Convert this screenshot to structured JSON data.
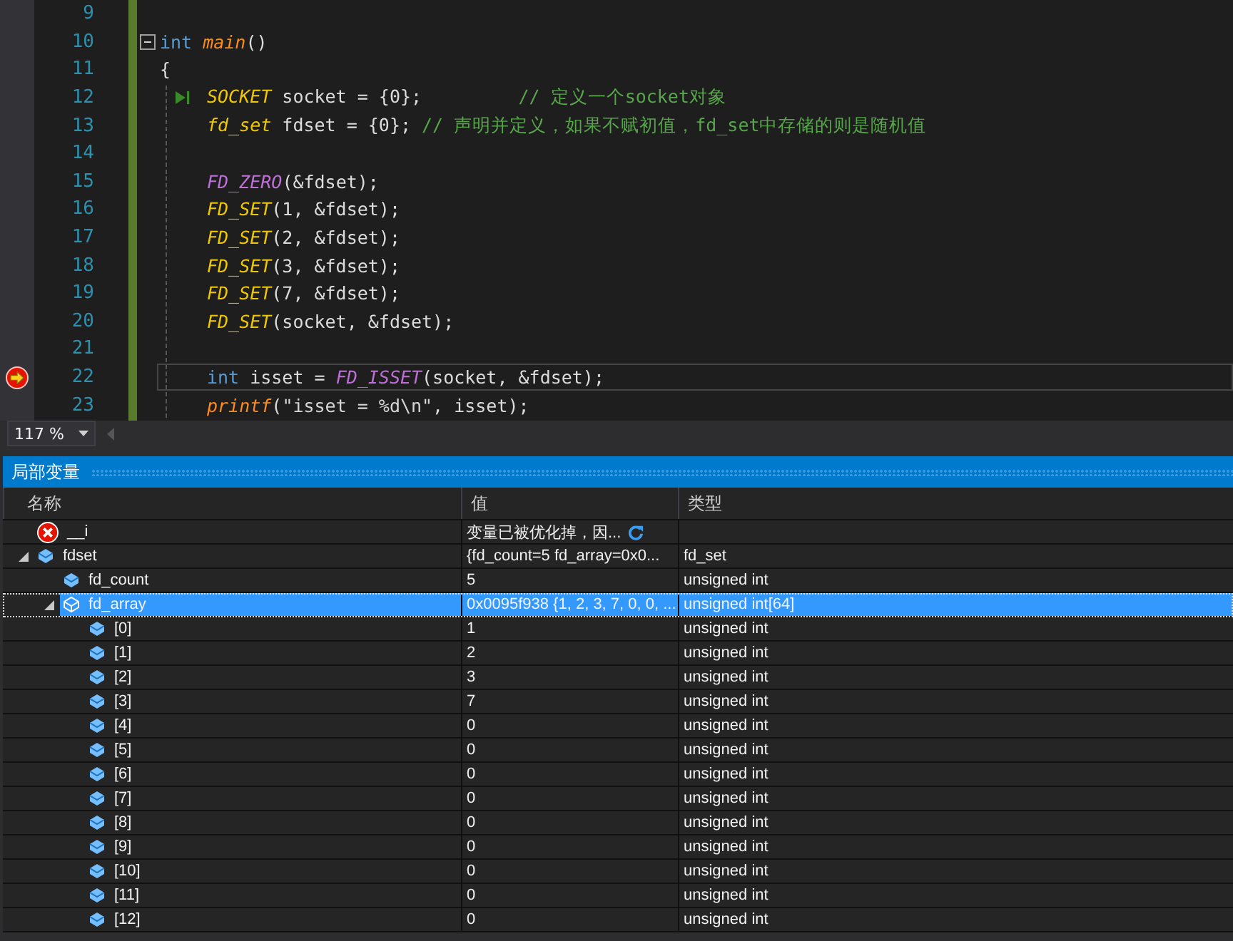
{
  "editor": {
    "lines": [
      {
        "number": "9"
      },
      {
        "number": "10",
        "collapsible": true,
        "tokens": [
          {
            "kind": "kw",
            "text": "int "
          },
          {
            "kind": "fn",
            "text": "main"
          },
          {
            "kind": "plain",
            "text": "()"
          }
        ]
      },
      {
        "number": "11",
        "tokens": [
          {
            "kind": "plain",
            "text": "{"
          }
        ],
        "children": [
          {
            "number": "12",
            "step_marker": true,
            "tokens": [
              {
                "kind": "type",
                "text": "SOCKET"
              },
              {
                "kind": "plain",
                "text": " socket = {0};         "
              },
              {
                "kind": "comment",
                "text": "// 定义一个socket对象"
              }
            ]
          },
          {
            "number": "13",
            "tokens": [
              {
                "kind": "type",
                "text": "fd_set"
              },
              {
                "kind": "plain",
                "text": " fdset = {0}; "
              },
              {
                "kind": "comment",
                "text": "// 声明并定义，如果不赋初值，fd_set中存储的则是随机值"
              }
            ]
          },
          {
            "number": "14"
          },
          {
            "number": "15",
            "tokens": [
              {
                "kind": "macro",
                "text": "FD_ZERO"
              },
              {
                "kind": "plain",
                "text": "(&fdset);"
              }
            ]
          },
          {
            "number": "16",
            "tokens": [
              {
                "kind": "type",
                "text": "FD_SET"
              },
              {
                "kind": "plain",
                "text": "(1, &fdset);"
              }
            ]
          },
          {
            "number": "17",
            "tokens": [
              {
                "kind": "type",
                "text": "FD_SET"
              },
              {
                "kind": "plain",
                "text": "(2, &fdset);"
              }
            ]
          },
          {
            "number": "18",
            "tokens": [
              {
                "kind": "type",
                "text": "FD_SET"
              },
              {
                "kind": "plain",
                "text": "(3, &fdset);"
              }
            ]
          },
          {
            "number": "19",
            "tokens": [
              {
                "kind": "type",
                "text": "FD_SET"
              },
              {
                "kind": "plain",
                "text": "(7, &fdset);"
              }
            ]
          },
          {
            "number": "20",
            "tokens": [
              {
                "kind": "type",
                "text": "FD_SET"
              },
              {
                "kind": "plain",
                "text": "(socket, &fdset);"
              }
            ]
          },
          {
            "number": "21"
          },
          {
            "number": "22",
            "current": true,
            "breakpoint": true,
            "tokens": [
              {
                "kind": "kw",
                "text": "int"
              },
              {
                "kind": "plain",
                "text": " isset = "
              },
              {
                "kind": "macro",
                "text": "FD_ISSET"
              },
              {
                "kind": "plain",
                "text": "(socket, &fdset);"
              }
            ]
          },
          {
            "number": "23",
            "tokens": [
              {
                "kind": "fn",
                "text": "printf"
              },
              {
                "kind": "plain",
                "text": "("
              },
              {
                "kind": "string",
                "text": "\"isset = %d\\n\""
              },
              {
                "kind": "plain",
                "text": ", isset);"
              }
            ]
          }
        ]
      }
    ]
  },
  "zoom": {
    "value": "117 %"
  },
  "locals": {
    "title": "局部变量",
    "columns": [
      "名称",
      "值",
      "类型"
    ],
    "rows": [
      {
        "kind": "error",
        "name": "__i",
        "value": "变量已被优化掉，因...",
        "refresh": true,
        "selected": false
      },
      {
        "kind": "variable",
        "name": "fdset",
        "value": "{fd_count=5 fd_array=0x0...",
        "type": "fd_set",
        "expanded": true,
        "selected": false,
        "children": [
          {
            "kind": "variable",
            "name": "fd_count",
            "value": "5",
            "type": "unsigned int",
            "selected": false
          },
          {
            "kind": "variable",
            "name": "fd_array",
            "value": "0x0095f938 {1, 2, 3, 7, 0, 0, ...",
            "type": "unsigned int[64]",
            "expanded": true,
            "selected": true,
            "children": [
              {
                "kind": "variable",
                "name": "[0]",
                "value": "1",
                "type": "unsigned int",
                "selected": false
              },
              {
                "kind": "variable",
                "name": "[1]",
                "value": "2",
                "type": "unsigned int",
                "selected": false
              },
              {
                "kind": "variable",
                "name": "[2]",
                "value": "3",
                "type": "unsigned int",
                "selected": false
              },
              {
                "kind": "variable",
                "name": "[3]",
                "value": "7",
                "type": "unsigned int",
                "selected": false
              },
              {
                "kind": "variable",
                "name": "[4]",
                "value": "0",
                "type": "unsigned int",
                "selected": false
              },
              {
                "kind": "variable",
                "name": "[5]",
                "value": "0",
                "type": "unsigned int",
                "selected": false
              },
              {
                "kind": "variable",
                "name": "[6]",
                "value": "0",
                "type": "unsigned int",
                "selected": false
              },
              {
                "kind": "variable",
                "name": "[7]",
                "value": "0",
                "type": "unsigned int",
                "selected": false
              },
              {
                "kind": "variable",
                "name": "[8]",
                "value": "0",
                "type": "unsigned int",
                "selected": false
              },
              {
                "kind": "variable",
                "name": "[9]",
                "value": "0",
                "type": "unsigned int",
                "selected": false
              },
              {
                "kind": "variable",
                "name": "[10]",
                "value": "0",
                "type": "unsigned int",
                "selected": false
              },
              {
                "kind": "variable",
                "name": "[11]",
                "value": "0",
                "type": "unsigned int",
                "selected": false
              },
              {
                "kind": "variable",
                "name": "[12]",
                "value": "0",
                "type": "unsigned int",
                "selected": false
              }
            ]
          }
        ]
      }
    ]
  }
}
